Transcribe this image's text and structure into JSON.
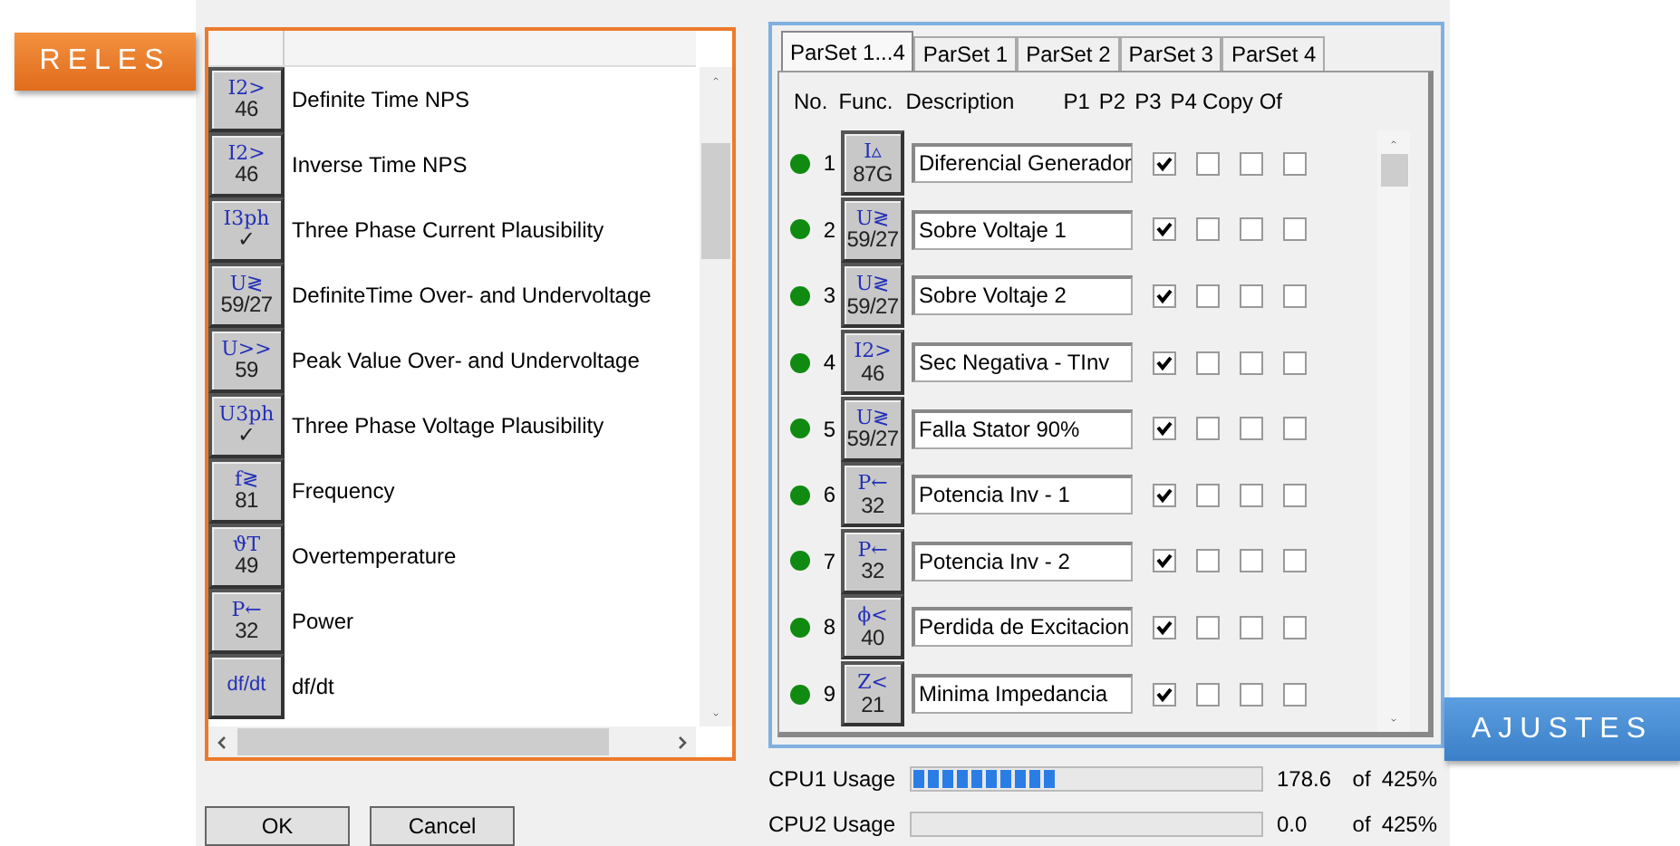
{
  "labels": {
    "left": "RELES",
    "right": "AJUSTES"
  },
  "functions": [
    {
      "symbol": "I2>",
      "code": "46",
      "name": "Definite Time NPS"
    },
    {
      "symbol": "I2>",
      "code": "46",
      "name": "Inverse Time NPS"
    },
    {
      "symbol": "I3ph",
      "code": "✓",
      "name": "Three Phase Current Plausibility"
    },
    {
      "symbol": "U≷",
      "code": "59/27",
      "name": "DefiniteTime Over- and Undervoltage"
    },
    {
      "symbol": "U>>",
      "code": "59",
      "name": "Peak Value Over- and Undervoltage"
    },
    {
      "symbol": "U3ph",
      "code": "✓",
      "name": "Three Phase Voltage Plausibility"
    },
    {
      "symbol": "f≷",
      "code": "81",
      "name": "Frequency"
    },
    {
      "symbol": "ϑT",
      "code": "49",
      "name": "Overtemperature"
    },
    {
      "symbol": "P←",
      "code": "32",
      "name": "Power"
    },
    {
      "symbol": "df/dt",
      "name": "df/dt"
    }
  ],
  "tabs": [
    {
      "label": "ParSet 1...4",
      "selected": true
    },
    {
      "label": "ParSet 1",
      "selected": false
    },
    {
      "label": "ParSet 2",
      "selected": false
    },
    {
      "label": "ParSet 3",
      "selected": false
    },
    {
      "label": "ParSet 4",
      "selected": false
    }
  ],
  "columns": [
    "No.",
    "Func.",
    "Description",
    "P1",
    "P2",
    "P3",
    "P4",
    "Copy Of"
  ],
  "rows": [
    {
      "active": true,
      "no": "1",
      "symbol": "I▵",
      "code": "87G",
      "description": "Diferencial Generador",
      "p1": true,
      "p2": false,
      "p3": false,
      "p4": false
    },
    {
      "active": true,
      "no": "2",
      "symbol": "U≷",
      "code": "59/27",
      "description": "Sobre Voltaje 1",
      "p1": true,
      "p2": false,
      "p3": false,
      "p4": false
    },
    {
      "active": true,
      "no": "3",
      "symbol": "U≷",
      "code": "59/27",
      "description": "Sobre Voltaje 2",
      "p1": true,
      "p2": false,
      "p3": false,
      "p4": false
    },
    {
      "active": true,
      "no": "4",
      "symbol": "I2>",
      "code": "46",
      "description": "Sec Negativa - TInv",
      "p1": true,
      "p2": false,
      "p3": false,
      "p4": false
    },
    {
      "active": true,
      "no": "5",
      "symbol": "U≷",
      "code": "59/27",
      "description": "Falla Stator 90%",
      "p1": true,
      "p2": false,
      "p3": false,
      "p4": false
    },
    {
      "active": true,
      "no": "6",
      "symbol": "P←",
      "code": "32",
      "description": "Potencia Inv - 1",
      "p1": true,
      "p2": false,
      "p3": false,
      "p4": false
    },
    {
      "active": true,
      "no": "7",
      "symbol": "P←",
      "code": "32",
      "description": "Potencia Inv - 2",
      "p1": true,
      "p2": false,
      "p3": false,
      "p4": false
    },
    {
      "active": true,
      "no": "8",
      "symbol": "ϕ<",
      "code": "40",
      "description": "Perdida de Excitacion",
      "p1": true,
      "p2": false,
      "p3": false,
      "p4": false
    },
    {
      "active": true,
      "no": "9",
      "symbol": "Z<",
      "code": "21",
      "description": "Minima Impedancia",
      "p1": true,
      "p2": false,
      "p3": false,
      "p4": false
    }
  ],
  "cpu": [
    {
      "label": "CPU1 Usage",
      "level": 0.42,
      "value": "178.6",
      "of": "of",
      "max": "425%"
    },
    {
      "label": "CPU2 Usage",
      "value": "0.0",
      "of": "of",
      "max": "425%"
    }
  ],
  "buttons": [
    "OK",
    "Cancel"
  ]
}
